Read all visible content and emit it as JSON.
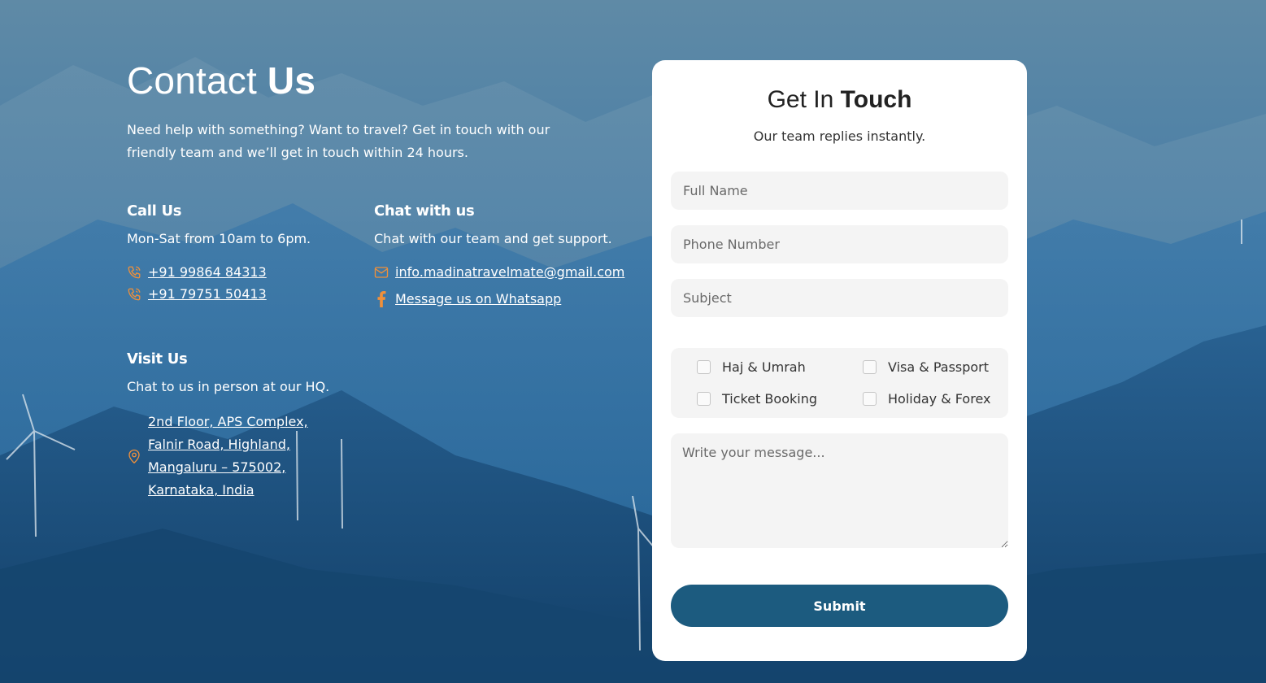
{
  "colors": {
    "accent": "#f0903a",
    "button": "#1c5b7f",
    "card": "#ffffff",
    "field_bg": "#f4f4f4"
  },
  "header": {
    "title_light": "Contact ",
    "title_bold": "Us",
    "intro": "Need help with something? Want to travel? Get in touch with our friendly team and we’ll get in touch within 24 hours."
  },
  "call": {
    "heading": "Call Us",
    "hours": "Mon-Sat  from 10am to 6pm.",
    "phones": [
      "+91 99864 84313",
      "+91 79751 50413"
    ],
    "icon": "phone-icon"
  },
  "chat": {
    "heading": "Chat with us",
    "text": "Chat with our team and get support.",
    "email": "info.madinatravelmate@gmail.com",
    "whatsapp": "Message us on Whatsapp",
    "email_icon": "mail-icon",
    "whatsapp_icon": "facebook-icon"
  },
  "visit": {
    "heading": "Visit Us",
    "text": "Chat to us in person at our HQ.",
    "address": "2nd Floor, APS Complex, Falnir Road, Highland, Mangaluru – 575002, Karnataka, India",
    "icon": "map-pin-icon"
  },
  "form": {
    "title_light": "Get In ",
    "title_bold": "Touch",
    "subtitle": "Our team replies instantly.",
    "name_placeholder": "Full Name",
    "phone_placeholder": "Phone Number",
    "subject_placeholder": "Subject",
    "services": [
      "Haj & Umrah",
      "Visa & Passport",
      "Ticket Booking",
      "Holiday & Forex"
    ],
    "message_placeholder": "Write your message...",
    "submit_label": "Submit"
  }
}
